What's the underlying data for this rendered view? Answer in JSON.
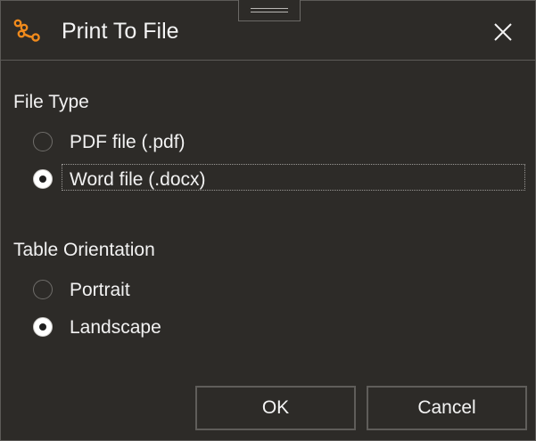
{
  "dialog": {
    "title": "Print To File",
    "app_icon": "orange-connected-nodes-icon",
    "accent_color": "#f08a1c",
    "close_icon": "close-icon"
  },
  "file_type": {
    "label": "File Type",
    "options": [
      {
        "label": "PDF file (.pdf)",
        "selected": false
      },
      {
        "label": "Word file (.docx)",
        "selected": true
      }
    ]
  },
  "table_orientation": {
    "label": "Table Orientation",
    "options": [
      {
        "label": "Portrait",
        "selected": false
      },
      {
        "label": "Landscape",
        "selected": true
      }
    ]
  },
  "buttons": {
    "ok": "OK",
    "cancel": "Cancel"
  }
}
